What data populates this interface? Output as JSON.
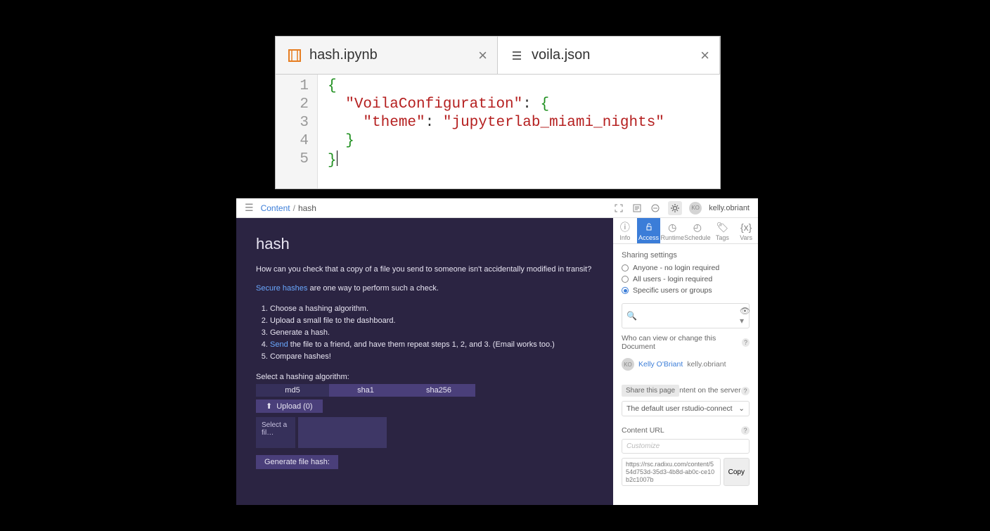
{
  "editor": {
    "tabs": [
      {
        "label": "hash.ipynb",
        "icon": "notebook-icon",
        "active": false
      },
      {
        "label": "voila.json",
        "icon": "json-icon",
        "active": true
      }
    ],
    "gutter": [
      "1",
      "2",
      "3",
      "4",
      "5"
    ],
    "code": {
      "l1_brace": "{",
      "l2_key": "\"VoilaConfiguration\"",
      "l2_colon": ": ",
      "l2_brace": "{",
      "l3_key": "\"theme\"",
      "l3_colon": ": ",
      "l3_val": "\"jupyterlab_miami_nights\"",
      "l4_brace": "}",
      "l5_brace": "}"
    }
  },
  "app": {
    "breadcrumb": {
      "root": "Content",
      "current": "hash"
    },
    "user": {
      "initials": "KO",
      "login": "kelly.obriant"
    },
    "dash": {
      "title": "hash",
      "intro": "How can you check that a copy of a file you send to someone isn't accidentally modified in transit?",
      "link1": "Secure hashes",
      "afterlink1": " are one way to perform such a check.",
      "steps": [
        "Choose a hashing algorithm.",
        "Upload a small file to the dashboard.",
        "Generate a hash.",
        "",
        "Compare hashes!"
      ],
      "step4_link": "Send",
      "step4_rest": " the file to a friend, and have them repeat steps 1, 2, and 3. (Email works too.)",
      "algo_label": "Select a hashing algorithm:",
      "algos": [
        "md5",
        "sha1",
        "sha256"
      ],
      "upload_label": "Upload (0)",
      "filepick_label": "Select a fil…",
      "gen_label": "Generate file hash:"
    },
    "settings": {
      "tabs": [
        "Info",
        "Access",
        "Runtime",
        "Schedule",
        "Tags",
        "Vars"
      ],
      "sharing_head": "Sharing settings",
      "radios": [
        "Anyone - no login required",
        "All users - login required",
        "Specific users or groups"
      ],
      "who_head": "Who can view or change this Document",
      "who_user": {
        "name": "Kelly O'Briant",
        "login": "kelly.obriant",
        "initials": "KO"
      },
      "share_pill": "Share this page",
      "exec_tail": "ntent on the server",
      "exec_select": "The default user rstudio-connect",
      "url_head": "Content URL",
      "url_placeholder": "Customize",
      "url_value": "https://rsc.radixu.com/content/554d753d-35d3-4b8d-ab0c-ce10b2c1007b",
      "copy_label": "Copy"
    }
  }
}
